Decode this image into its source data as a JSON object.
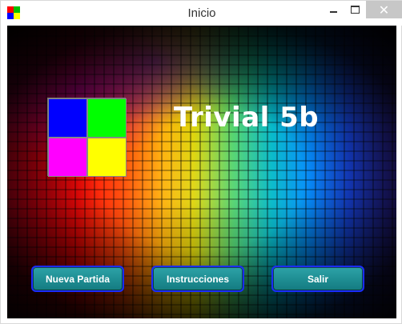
{
  "window": {
    "title": "Inicio",
    "app_icon_colors": [
      "#ff0000",
      "#00c000",
      "#0000ff",
      "#ffff00"
    ],
    "controls": {
      "minimize_icon": "minimize-icon",
      "maximize_icon": "maximize-icon",
      "close_glyph": "✕"
    }
  },
  "main": {
    "title": "Trivial 5b",
    "logo_colors": [
      "#0000ff",
      "#00ff00",
      "#ff00ff",
      "#ffff00"
    ],
    "buttons": {
      "new_game": "Nueva Partida",
      "instructions": "Instrucciones",
      "exit": "Salir"
    }
  },
  "colors": {
    "button_border": "#1a2cff",
    "button_fill": "#1f8f94",
    "title_text": "#ffffff"
  }
}
